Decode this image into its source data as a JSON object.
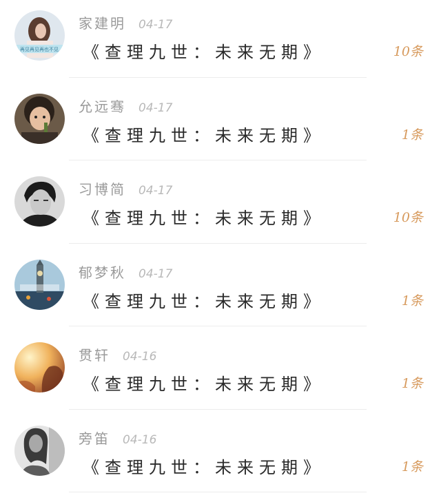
{
  "theme": {
    "name_color": "#9a9a9a",
    "date_color": "#b8b8b8",
    "title_color": "#2a2a2a",
    "count_color": "#d79a5d"
  },
  "items": [
    {
      "name": "家建明",
      "date": "04-17",
      "title": "《查理九世：未来无期》",
      "count": "10条",
      "avatar": "girl-with-caption-avatar"
    },
    {
      "name": "允远骞",
      "date": "04-17",
      "title": "《查理九世：未来无期》",
      "count": "1条",
      "avatar": "child-avatar"
    },
    {
      "name": "习博简",
      "date": "04-17",
      "title": "《查理九世：未来无期》",
      "count": "10条",
      "avatar": "man-portrait-avatar"
    },
    {
      "name": "郁梦秋",
      "date": "04-17",
      "title": "《查理九世：未来无期》",
      "count": "1条",
      "avatar": "big-ben-avatar"
    },
    {
      "name": "贯轩",
      "date": "04-16",
      "title": "《查理九世：未来无期》",
      "count": "1条",
      "avatar": "sunset-silhouette-avatar"
    },
    {
      "name": "旁笛",
      "date": "04-16",
      "title": "《查理九世：未来无期》",
      "count": "1条",
      "avatar": "monochrome-woman-avatar"
    }
  ],
  "avatar_captions": {
    "item0": "再见再见再也不见"
  }
}
